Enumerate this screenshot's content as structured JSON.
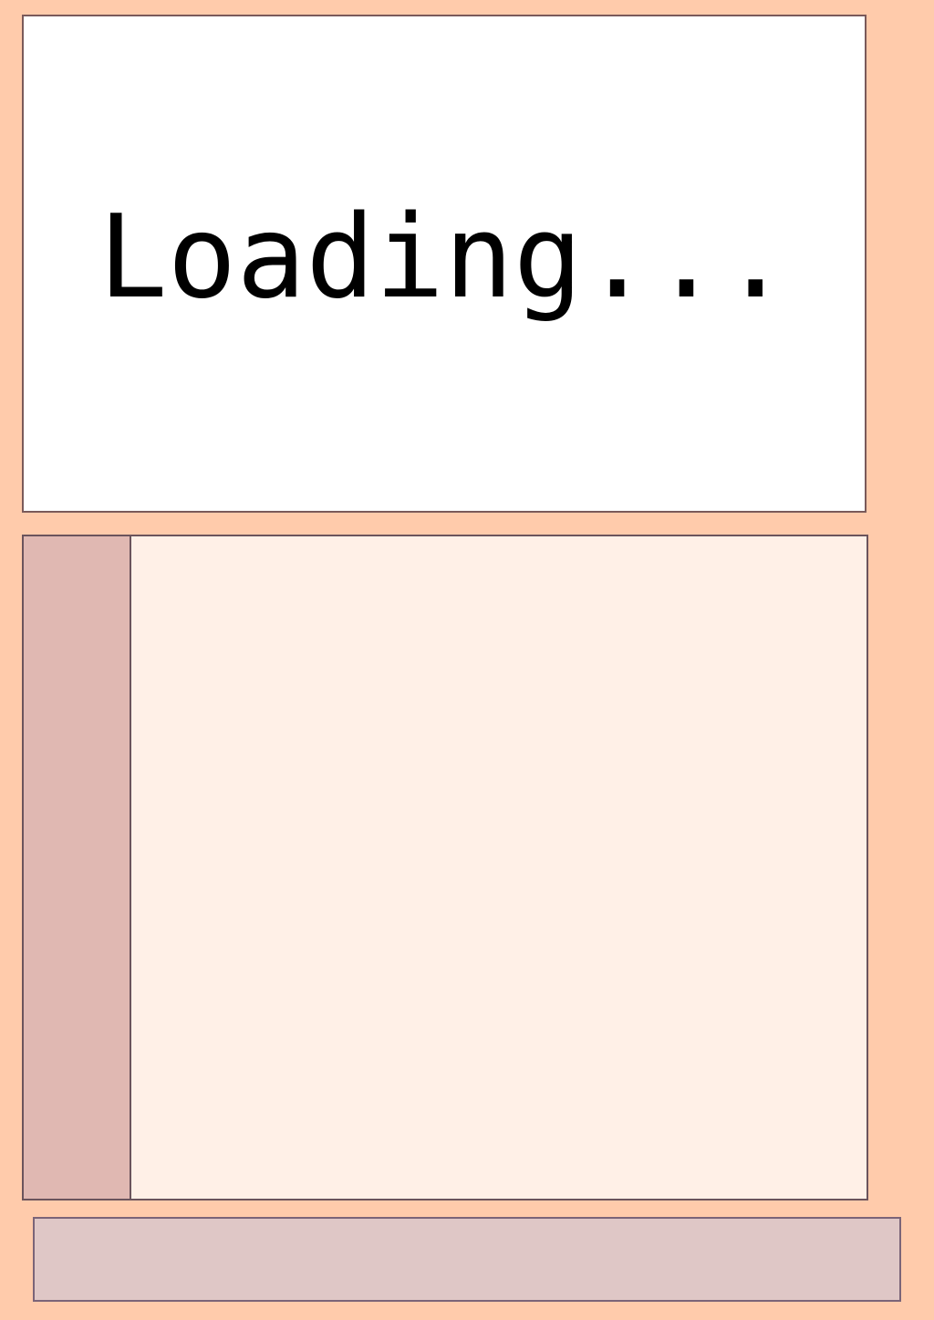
{
  "loading": {
    "text": "Loading..."
  },
  "colors": {
    "page_background": "#ffcbab",
    "loading_panel_background": "#ffffff",
    "content_panel_background": "#fff0e7",
    "side_strip_background": "#e0b8b2",
    "bottom_bar_background": "#dfc7c6",
    "border": "#6b545c"
  }
}
